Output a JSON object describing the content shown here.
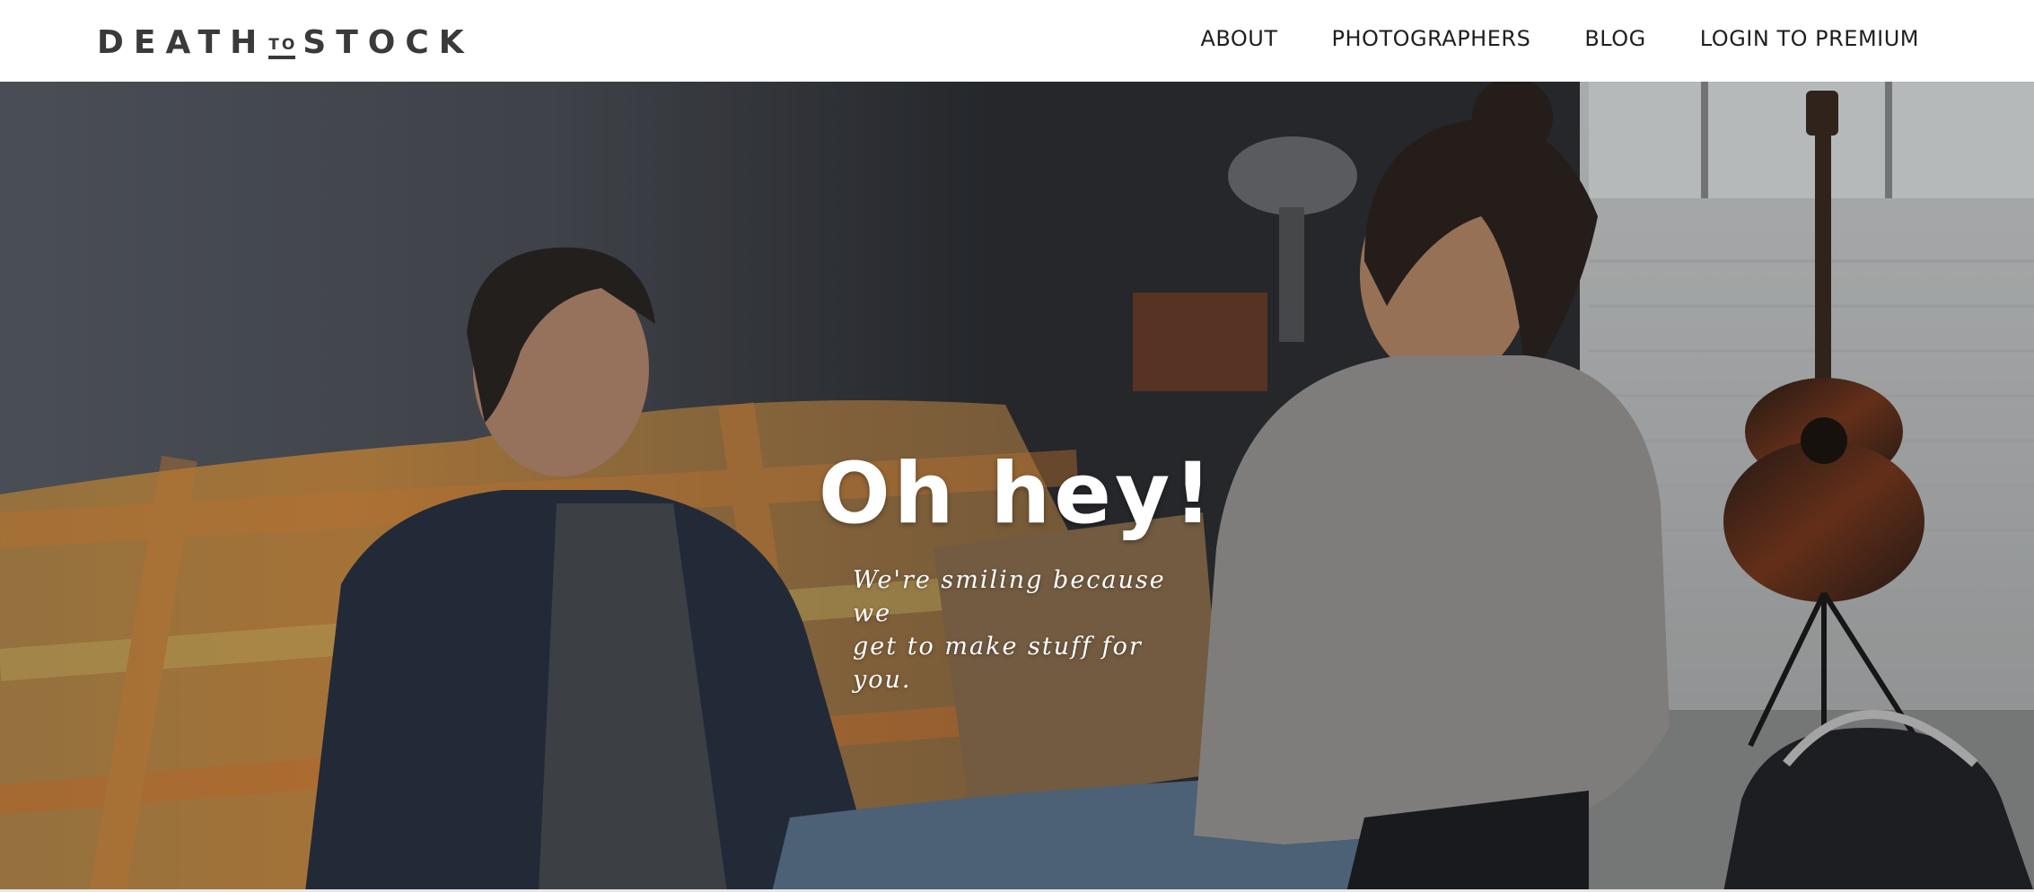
{
  "brand": {
    "logo_part1": "DEATH",
    "logo_middle": "TO",
    "logo_part2": "STOCK"
  },
  "nav": {
    "items": [
      {
        "label": "ABOUT"
      },
      {
        "label": "PHOTOGRAPHERS"
      },
      {
        "label": "BLOG"
      },
      {
        "label": "LOGIN TO PREMIUM"
      }
    ]
  },
  "hero": {
    "title": "Oh hey!",
    "subtitle_line1": "We're smiling because we",
    "subtitle_line2": "get to make stuff for you."
  },
  "colors": {
    "logo": "#3a3a3c",
    "nav_text": "#1f1f22",
    "hero_text": "#ffffff"
  }
}
